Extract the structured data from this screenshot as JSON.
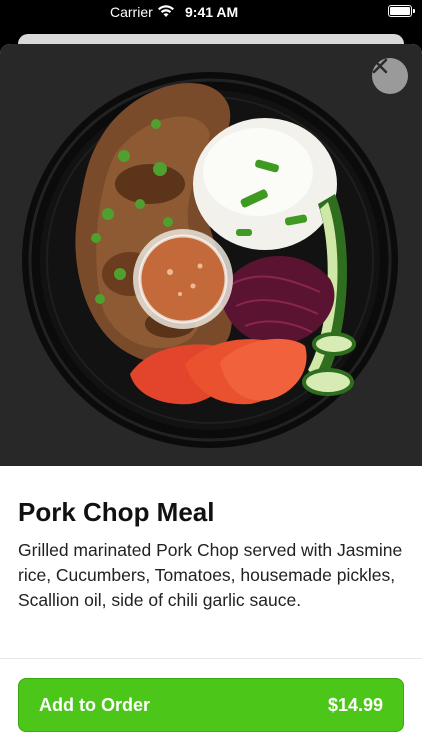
{
  "status_bar": {
    "carrier": "Carrier",
    "time": "9:41 AM"
  },
  "item": {
    "name": "Pork Chop Meal",
    "description": "Grilled marinated Pork Chop served with Jasmine rice, Cucumbers, Tomatoes, housemade pickles, Scallion oil, side of chili garlic sauce."
  },
  "action": {
    "add_label": "Add to Order",
    "price": "$14.99",
    "color": "#4cc619"
  },
  "icons": {
    "close": "close-icon",
    "wifi": "wifi-icon",
    "battery": "battery-icon"
  }
}
